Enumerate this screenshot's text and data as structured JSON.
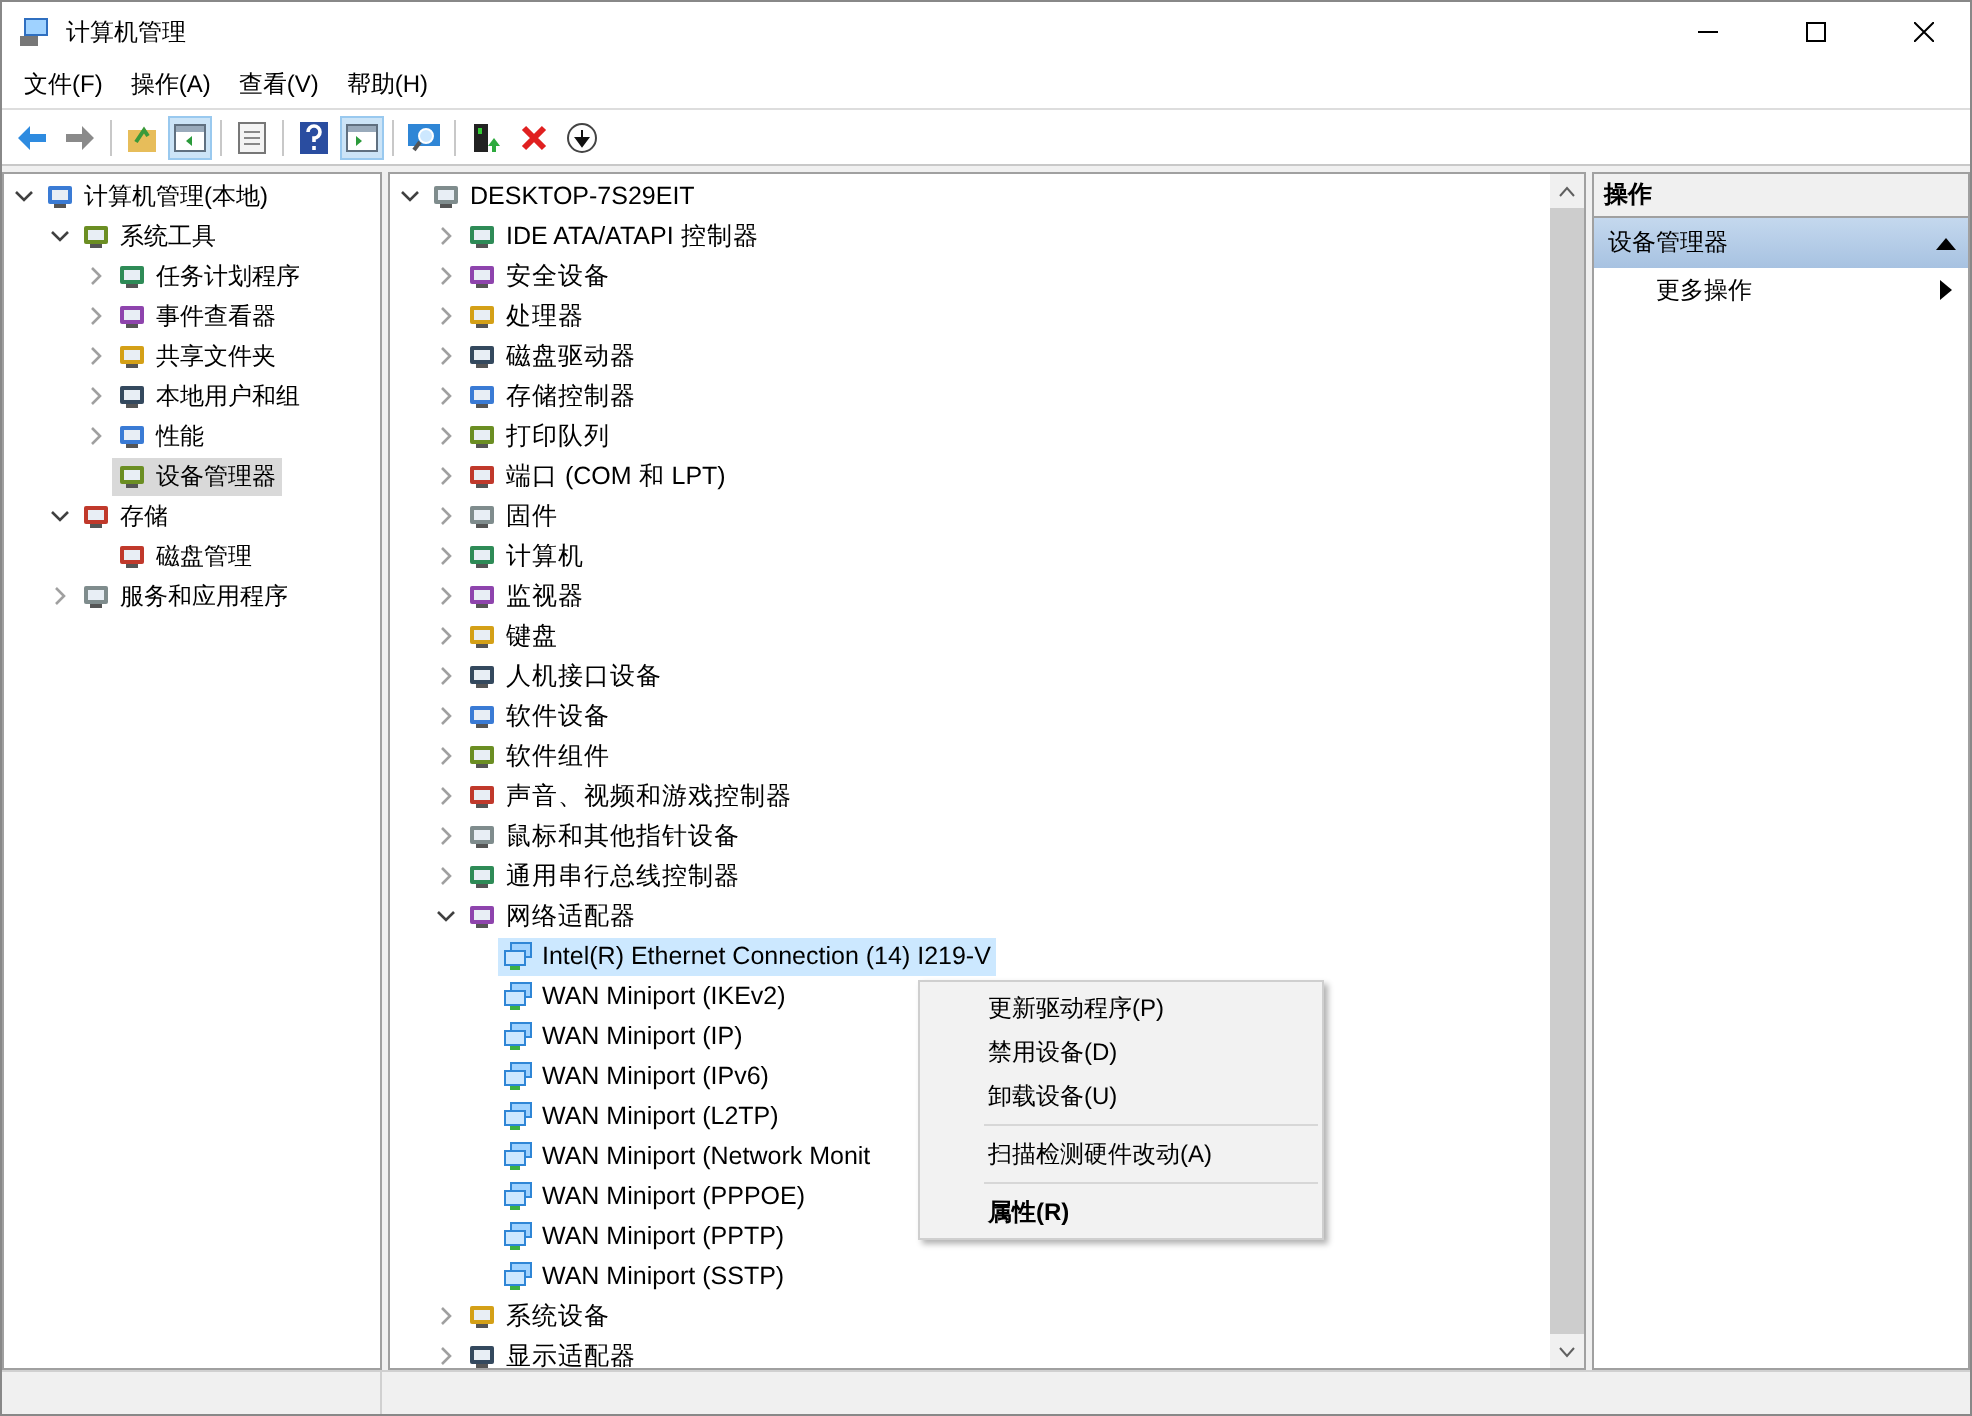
{
  "window": {
    "title": "计算机管理"
  },
  "menu_bar": [
    "文件(F)",
    "操作(A)",
    "查看(V)",
    "帮助(H)"
  ],
  "toolbar": [
    {
      "pressed": false
    },
    {
      "pressed": false
    },
    {
      "pressed": false
    },
    {
      "pressed": true
    },
    {
      "pressed": false
    },
    {
      "pressed": false
    },
    {
      "pressed": true
    },
    {
      "pressed": false
    },
    {
      "pressed": false
    },
    {
      "pressed": false
    },
    {
      "pressed": false
    }
  ],
  "console_tree": [
    {
      "label": "计算机管理(本地)",
      "expanded": true,
      "selected": false,
      "children": [
        {
          "label": "系统工具",
          "expanded": true,
          "selected": false,
          "children": [
            {
              "label": "任务计划程序",
              "expanded": false,
              "selected": false
            },
            {
              "label": "事件查看器",
              "expanded": false,
              "selected": false
            },
            {
              "label": "共享文件夹",
              "expanded": false,
              "selected": false
            },
            {
              "label": "本地用户和组",
              "expanded": false,
              "selected": false
            },
            {
              "label": "性能",
              "expanded": false,
              "selected": false
            },
            {
              "label": "设备管理器",
              "selected": true
            }
          ]
        },
        {
          "label": "存储",
          "expanded": true,
          "selected": false,
          "children": [
            {
              "label": "磁盘管理",
              "selected": false
            }
          ]
        },
        {
          "label": "服务和应用程序",
          "expanded": false,
          "selected": false
        }
      ]
    }
  ],
  "device_tree": [
    {
      "label": "DESKTOP-7S29EIT",
      "expanded": true,
      "selected": false,
      "children": [
        {
          "label": "IDE ATA/ATAPI 控制器",
          "expanded": false,
          "selected": false
        },
        {
          "label": "安全设备",
          "expanded": false,
          "selected": false
        },
        {
          "label": "处理器",
          "expanded": false,
          "selected": false
        },
        {
          "label": "磁盘驱动器",
          "expanded": false,
          "selected": false
        },
        {
          "label": "存储控制器",
          "expanded": false,
          "selected": false
        },
        {
          "label": "打印队列",
          "expanded": false,
          "selected": false
        },
        {
          "label": "端口 (COM 和 LPT)",
          "expanded": false,
          "selected": false
        },
        {
          "label": "固件",
          "expanded": false,
          "selected": false
        },
        {
          "label": "计算机",
          "expanded": false,
          "selected": false
        },
        {
          "label": "监视器",
          "expanded": false,
          "selected": false
        },
        {
          "label": "键盘",
          "expanded": false,
          "selected": false
        },
        {
          "label": "人机接口设备",
          "expanded": false,
          "selected": false
        },
        {
          "label": "软件设备",
          "expanded": false,
          "selected": false
        },
        {
          "label": "软件组件",
          "expanded": false,
          "selected": false
        },
        {
          "label": "声音、视频和游戏控制器",
          "expanded": false,
          "selected": false
        },
        {
          "label": "鼠标和其他指针设备",
          "expanded": false,
          "selected": false
        },
        {
          "label": "通用串行总线控制器",
          "expanded": false,
          "selected": false
        },
        {
          "label": "网络适配器",
          "expanded": true,
          "selected": false,
          "children": [
            {
              "label": "Intel(R) Ethernet Connection (14) I219-V",
              "selected": true
            },
            {
              "label": "WAN Miniport (IKEv2)",
              "selected": false
            },
            {
              "label": "WAN Miniport (IP)",
              "selected": false
            },
            {
              "label": "WAN Miniport (IPv6)",
              "selected": false
            },
            {
              "label": "WAN Miniport (L2TP)",
              "selected": false
            },
            {
              "label": "WAN Miniport (Network Monit",
              "selected": false
            },
            {
              "label": "WAN Miniport (PPPOE)",
              "selected": false
            },
            {
              "label": "WAN Miniport (PPTP)",
              "selected": false
            },
            {
              "label": "WAN Miniport (SSTP)",
              "selected": false
            }
          ]
        },
        {
          "label": "系统设备",
          "expanded": false,
          "selected": false
        },
        {
          "label": "显示适配器",
          "expanded": false,
          "selected": false
        }
      ]
    }
  ],
  "context_menu": [
    [
      {
        "label": "更新驱动程序(P)",
        "default": false
      },
      {
        "label": "禁用设备(D)",
        "default": false
      },
      {
        "label": "卸载设备(U)",
        "default": false
      }
    ],
    [
      {
        "label": "扫描检测硬件改动(A)",
        "default": false
      }
    ],
    [
      {
        "label": "属性(R)",
        "default": true
      }
    ]
  ],
  "actions_pane": {
    "title": "操作",
    "section": {
      "label": "设备管理器",
      "expanded": true
    },
    "items": [
      "更多操作"
    ]
  }
}
